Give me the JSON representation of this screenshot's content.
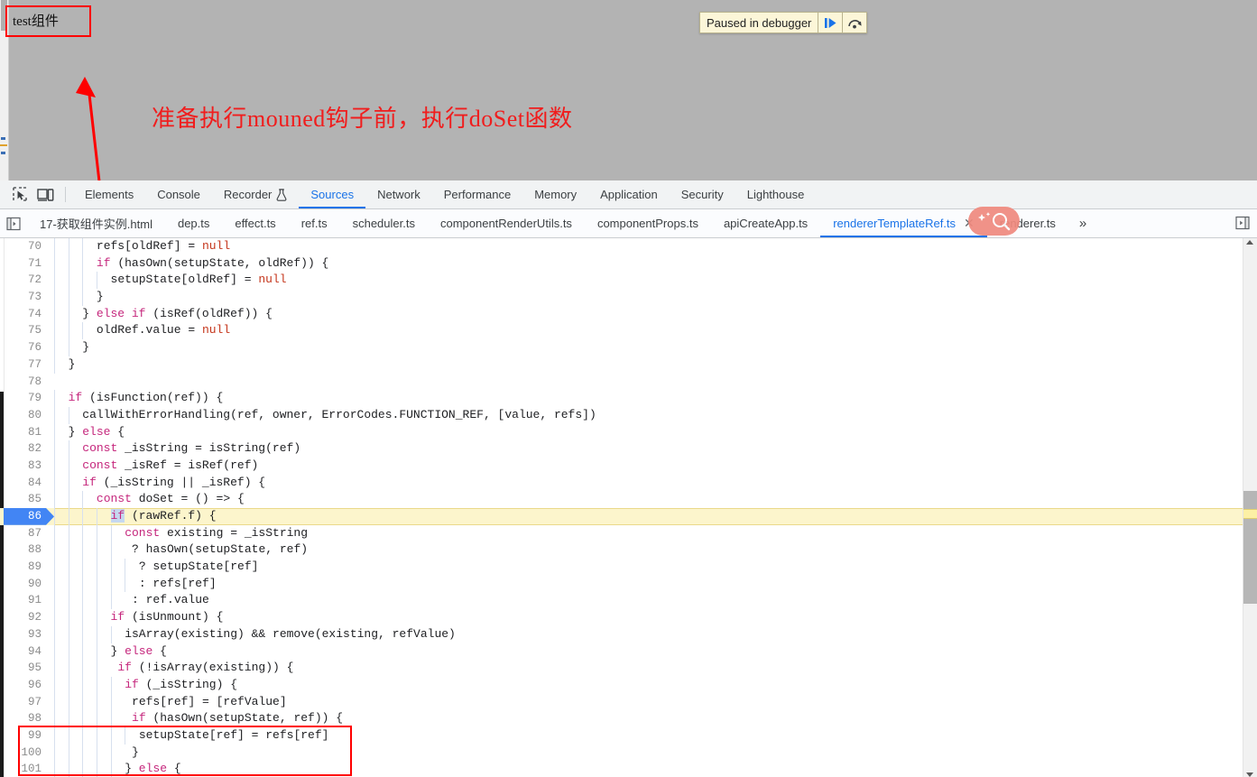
{
  "page": {
    "component_label": "test组件",
    "annotation": "准备执行mouned钩子前，执行doSet函数",
    "paused_banner": {
      "label": "Paused in debugger",
      "resume_icon": "resume-script-icon",
      "step_over_icon": "step-over-icon"
    }
  },
  "devtools": {
    "toolbar_icons": [
      {
        "name": "inspect-element-icon"
      },
      {
        "name": "device-toolbar-icon"
      }
    ],
    "main_tabs": [
      {
        "label": "Elements",
        "active": false
      },
      {
        "label": "Console",
        "active": false
      },
      {
        "label": "Recorder",
        "active": false,
        "icon": "flask-icon"
      },
      {
        "label": "Sources",
        "active": true
      },
      {
        "label": "Network",
        "active": false
      },
      {
        "label": "Performance",
        "active": false
      },
      {
        "label": "Memory",
        "active": false
      },
      {
        "label": "Application",
        "active": false
      },
      {
        "label": "Security",
        "active": false
      },
      {
        "label": "Lighthouse",
        "active": false
      }
    ],
    "file_tabs": [
      {
        "label": "17-获取组件实例.html",
        "active": false,
        "closable": false
      },
      {
        "label": "dep.ts",
        "active": false,
        "closable": false
      },
      {
        "label": "effect.ts",
        "active": false,
        "closable": false
      },
      {
        "label": "ref.ts",
        "active": false,
        "closable": false
      },
      {
        "label": "scheduler.ts",
        "active": false,
        "closable": false
      },
      {
        "label": "componentRenderUtils.ts",
        "active": false,
        "closable": false
      },
      {
        "label": "componentProps.ts",
        "active": false,
        "closable": false
      },
      {
        "label": "apiCreateApp.ts",
        "active": false,
        "closable": false
      },
      {
        "label": "rendererTemplateRef.ts",
        "active": true,
        "closable": true,
        "close_label": "✕"
      },
      {
        "label": "renderer.ts",
        "active": false,
        "closable": false
      }
    ],
    "file_tabs_more": "»",
    "panel_toggle_left_icon": "show-navigator-icon",
    "panel_toggle_right_icon": "show-debugger-icon",
    "cursor_overlay_icon": "sparkle-magnifier-icon",
    "accent_color": "#1a73e8",
    "highlight_color": "#fcf5cc",
    "annotation_color": "#ff0000"
  },
  "editor": {
    "current_line": 86,
    "lines": [
      {
        "num": 70,
        "indent": 6,
        "tokens": [
          {
            "t": "refs[oldRef] = ",
            "c": ""
          },
          {
            "t": "null",
            "c": "tok-null"
          }
        ]
      },
      {
        "num": 71,
        "indent": 6,
        "tokens": [
          {
            "t": "if",
            "c": "tok-key"
          },
          {
            "t": " (hasOwn(setupState, oldRef)) {",
            "c": ""
          }
        ]
      },
      {
        "num": 72,
        "indent": 8,
        "tokens": [
          {
            "t": "setupState[oldRef] = ",
            "c": ""
          },
          {
            "t": "null",
            "c": "tok-null"
          }
        ]
      },
      {
        "num": 73,
        "indent": 6,
        "tokens": [
          {
            "t": "}",
            "c": ""
          }
        ]
      },
      {
        "num": 74,
        "indent": 4,
        "tokens": [
          {
            "t": "} ",
            "c": ""
          },
          {
            "t": "else if",
            "c": "tok-key"
          },
          {
            "t": " (isRef(oldRef)) {",
            "c": ""
          }
        ]
      },
      {
        "num": 75,
        "indent": 6,
        "tokens": [
          {
            "t": "oldRef.value = ",
            "c": ""
          },
          {
            "t": "null",
            "c": "tok-null"
          }
        ]
      },
      {
        "num": 76,
        "indent": 4,
        "tokens": [
          {
            "t": "}",
            "c": ""
          }
        ]
      },
      {
        "num": 77,
        "indent": 2,
        "tokens": [
          {
            "t": "}",
            "c": ""
          }
        ]
      },
      {
        "num": 78,
        "indent": 0,
        "tokens": [
          {
            "t": "",
            "c": ""
          }
        ]
      },
      {
        "num": 79,
        "indent": 2,
        "tokens": [
          {
            "t": "if",
            "c": "tok-key"
          },
          {
            "t": " (isFunction(ref)) {",
            "c": ""
          }
        ]
      },
      {
        "num": 80,
        "indent": 4,
        "tokens": [
          {
            "t": "callWithErrorHandling(ref, owner, ErrorCodes.FUNCTION_REF, [value, refs])",
            "c": ""
          }
        ]
      },
      {
        "num": 81,
        "indent": 2,
        "tokens": [
          {
            "t": "} ",
            "c": ""
          },
          {
            "t": "else",
            "c": "tok-key"
          },
          {
            "t": " {",
            "c": ""
          }
        ]
      },
      {
        "num": 82,
        "indent": 4,
        "tokens": [
          {
            "t": "const",
            "c": "tok-key"
          },
          {
            "t": " _isString = isString(ref)",
            "c": ""
          }
        ]
      },
      {
        "num": 83,
        "indent": 4,
        "tokens": [
          {
            "t": "const",
            "c": "tok-key"
          },
          {
            "t": " _isRef = isRef(ref)",
            "c": ""
          }
        ]
      },
      {
        "num": 84,
        "indent": 4,
        "tokens": [
          {
            "t": "if",
            "c": "tok-key"
          },
          {
            "t": " (_isString || _isRef) {",
            "c": ""
          }
        ]
      },
      {
        "num": 85,
        "indent": 6,
        "tokens": [
          {
            "t": "const",
            "c": "tok-key"
          },
          {
            "t": " doSet = () => {",
            "c": ""
          }
        ]
      },
      {
        "num": 86,
        "indent": 8,
        "tokens": [
          {
            "t": "if",
            "c": "tok-key tok-sel"
          },
          {
            "t": " (rawRef.f) {",
            "c": ""
          }
        ]
      },
      {
        "num": 87,
        "indent": 10,
        "tokens": [
          {
            "t": "const",
            "c": "tok-key"
          },
          {
            "t": " existing = _isString",
            "c": ""
          }
        ]
      },
      {
        "num": 88,
        "indent": 11,
        "tokens": [
          {
            "t": "? hasOwn(setupState, ref)",
            "c": ""
          }
        ]
      },
      {
        "num": 89,
        "indent": 12,
        "tokens": [
          {
            "t": "? setupState[ref]",
            "c": ""
          }
        ]
      },
      {
        "num": 90,
        "indent": 12,
        "tokens": [
          {
            "t": ": refs[ref]",
            "c": ""
          }
        ]
      },
      {
        "num": 91,
        "indent": 11,
        "tokens": [
          {
            "t": ": ref.value",
            "c": ""
          }
        ]
      },
      {
        "num": 92,
        "indent": 8,
        "tokens": [
          {
            "t": "if",
            "c": "tok-key"
          },
          {
            "t": " (isUnmount) {",
            "c": ""
          }
        ]
      },
      {
        "num": 93,
        "indent": 10,
        "tokens": [
          {
            "t": "isArray(existing) && remove(existing, refValue)",
            "c": ""
          }
        ]
      },
      {
        "num": 94,
        "indent": 8,
        "tokens": [
          {
            "t": "} ",
            "c": ""
          },
          {
            "t": "else",
            "c": "tok-key"
          },
          {
            "t": " {",
            "c": ""
          }
        ]
      },
      {
        "num": 95,
        "indent": 9,
        "tokens": [
          {
            "t": "if",
            "c": "tok-key"
          },
          {
            "t": " (!isArray(existing)) {",
            "c": ""
          }
        ]
      },
      {
        "num": 96,
        "indent": 10,
        "tokens": [
          {
            "t": "if",
            "c": "tok-key"
          },
          {
            "t": " (_isString) {",
            "c": ""
          }
        ]
      },
      {
        "num": 97,
        "indent": 11,
        "tokens": [
          {
            "t": "refs[ref] = [refValue]",
            "c": ""
          }
        ]
      },
      {
        "num": 98,
        "indent": 11,
        "tokens": [
          {
            "t": "if",
            "c": "tok-key"
          },
          {
            "t": " (hasOwn(setupState, ref)) {",
            "c": ""
          }
        ]
      },
      {
        "num": 99,
        "indent": 12,
        "tokens": [
          {
            "t": "setupState[ref] = refs[ref]",
            "c": ""
          }
        ]
      },
      {
        "num": 100,
        "indent": 11,
        "tokens": [
          {
            "t": "}",
            "c": ""
          }
        ]
      },
      {
        "num": 101,
        "indent": 10,
        "tokens": [
          {
            "t": "} ",
            "c": ""
          },
          {
            "t": "else",
            "c": "tok-key"
          },
          {
            "t": " {",
            "c": ""
          }
        ]
      }
    ]
  }
}
